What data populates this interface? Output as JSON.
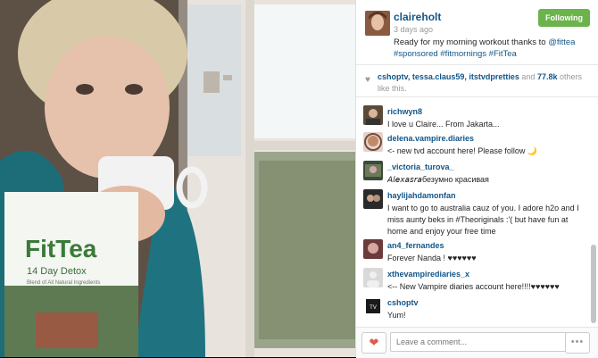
{
  "post": {
    "username": "claireholt",
    "time": "3 days ago",
    "follow_label": "Following",
    "caption_text": "Ready for my morning workout thanks to ",
    "caption_mention": "@fittea",
    "caption_tags": "#sponsored #fitmornings #FitTea"
  },
  "likes": {
    "users": "cshoptv, tessa.claus59, itstvdpretties",
    "and_text": " and ",
    "count": "77.8k",
    "suffix": " others like this."
  },
  "comments": [
    {
      "user": "richwyn8",
      "text": "I love u Claire... From Jakarta..."
    },
    {
      "user": "delena.vampire.diaries",
      "text": "<- new tvd account here! Please follow 🌙"
    },
    {
      "user": "_victoria_turova_",
      "text": "𝘈𝘭𝘦𝘹𝘢𝘴𝘳𝘢безумно красивая"
    },
    {
      "user": "haylijahdamonfan",
      "text": "I want to go to australia cauz of you. I adore h2o and I miss aunty beks in #Theoriginals :'( but have fun at home and enjoy your free time"
    },
    {
      "user": "an4_fernandes",
      "text": "Forever Nanda ! ♥♥♥♥♥♥"
    },
    {
      "user": "xthevampirediaries_x",
      "text": "<-- New Vampire diaries account here!!!!♥♥♥♥♥♥"
    },
    {
      "user": "cshoptv",
      "text": "Yum!"
    }
  ],
  "footer": {
    "comment_placeholder": "Leave a comment...",
    "more_label": "•••",
    "heart": "❤"
  },
  "photo": {
    "brand": "FitTea",
    "product": "14 Day Detox",
    "tagline": "Blend of All Natural Ingredients"
  }
}
